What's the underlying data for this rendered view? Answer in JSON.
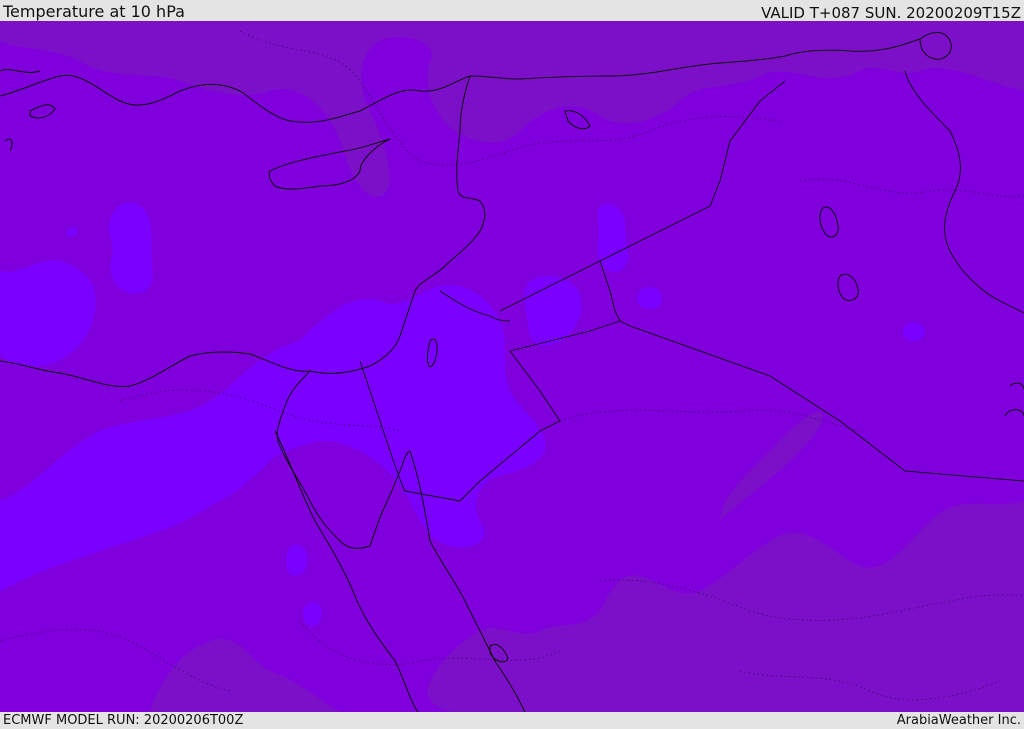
{
  "header": {
    "title": "Temperature at 10 hPa",
    "valid": "VALID T+087 SUN. 20200209T15Z"
  },
  "footer": {
    "model_run": "ECMWF MODEL RUN: 20200206T00Z",
    "credit": "ArabiaWeather Inc."
  },
  "map": {
    "palette": {
      "band_warm": "#7b10c8",
      "band_mid": "#7f00dd",
      "band_cool": "#7a00ff",
      "band_coolest": "#8a21ff",
      "coastline": "#111111",
      "contour": "#3c0a6a"
    }
  }
}
